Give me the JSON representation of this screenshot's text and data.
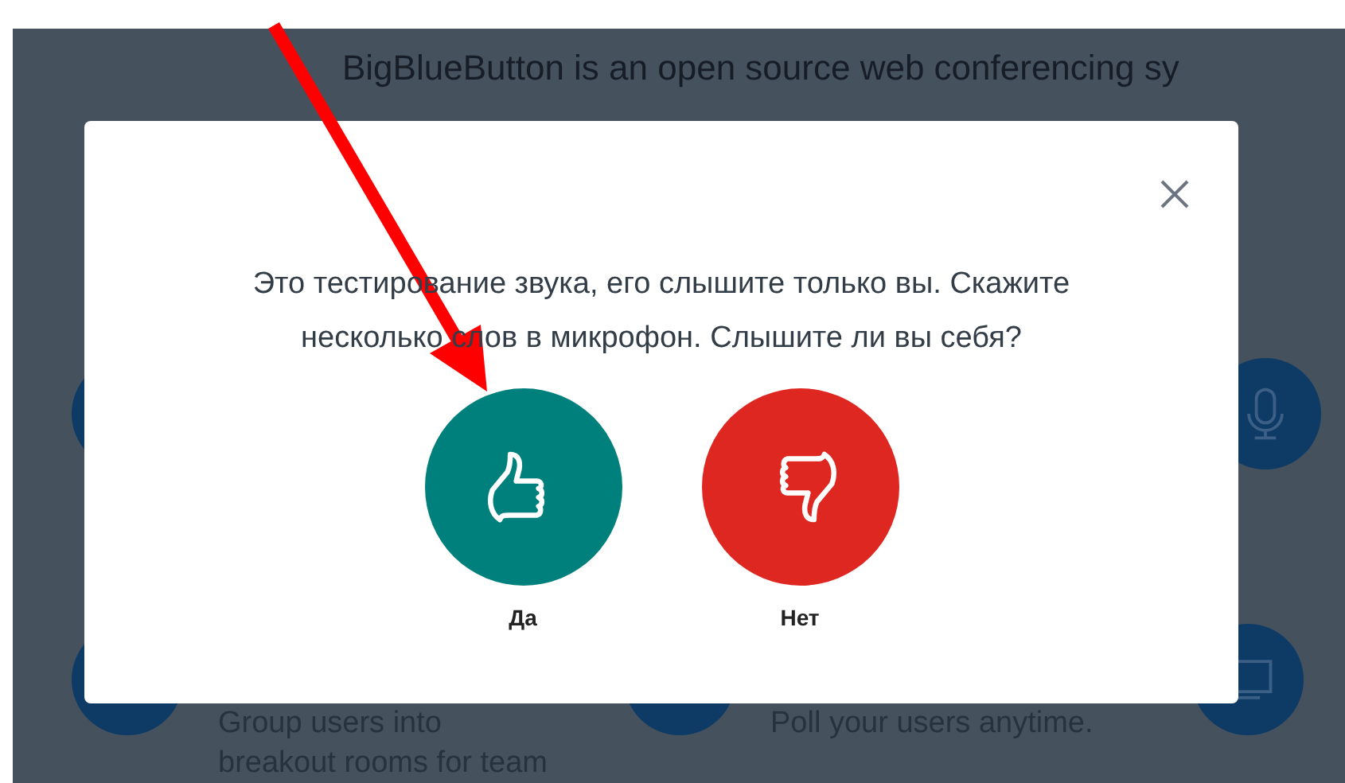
{
  "background": {
    "intro": "BigBlueButton is an open source web conferencing sy",
    "features": [
      {
        "lines": [
          "Group users into",
          "breakout rooms for team"
        ]
      },
      {
        "lines": [
          "Poll your users anytime."
        ]
      }
    ]
  },
  "dialog": {
    "message": "Это тестирование звука, его слышите только вы. Скажите несколько слов в микрофон. Слышите ли вы себя?",
    "choices": [
      {
        "kind": "yes",
        "label": "Да"
      },
      {
        "kind": "no",
        "label": "Нет"
      }
    ]
  }
}
